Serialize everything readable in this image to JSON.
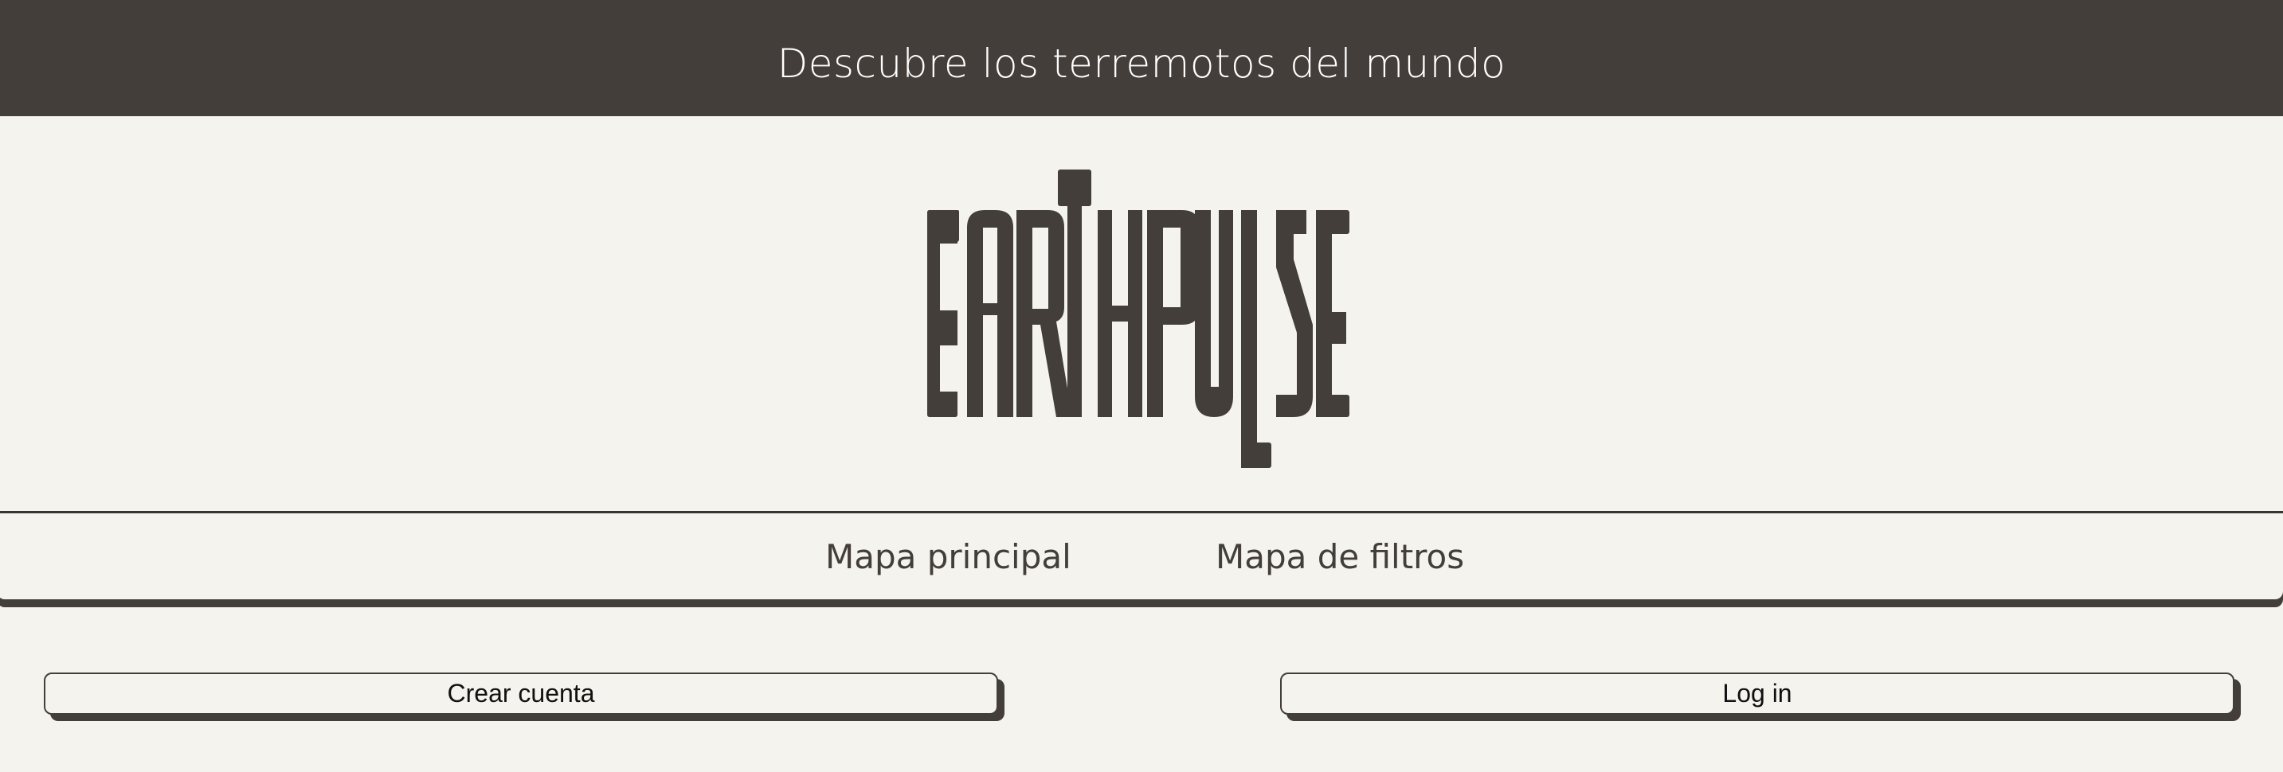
{
  "header": {
    "tagline": "Descubre los terremotos del mundo"
  },
  "logo": {
    "text": "EARTHPULSE",
    "color": "#433e3a"
  },
  "nav": {
    "items": [
      {
        "label": "Mapa principal"
      },
      {
        "label": "Mapa de filtros"
      }
    ]
  },
  "auth": {
    "create_account_label": "Crear cuenta",
    "login_label": "Log in"
  },
  "colors": {
    "dark": "#433e3a",
    "background": "#f4f3ee"
  }
}
